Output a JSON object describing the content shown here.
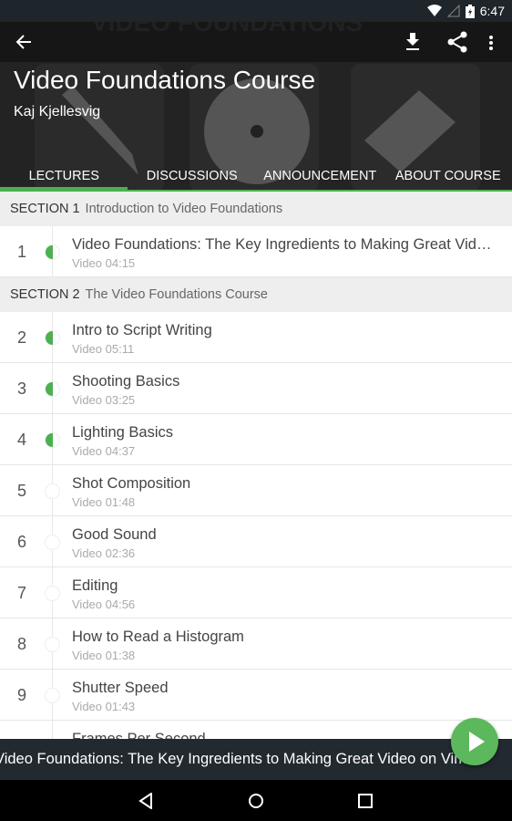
{
  "status_bar": {
    "time": "6:47",
    "icons": [
      "wifi-icon",
      "signal-icon",
      "battery-charging-icon"
    ]
  },
  "header": {
    "title": "Video Foundations Course",
    "author": "Kaj Kjellesvig",
    "actions": [
      "back-icon",
      "download-icon",
      "share-icon",
      "more-vert-icon"
    ]
  },
  "tabs": [
    {
      "label": "LECTURES",
      "active": true
    },
    {
      "label": "DISCUSSIONS"
    },
    {
      "label": "ANNOUNCEMENT"
    },
    {
      "label": "ABOUT COURSE"
    }
  ],
  "sections": [
    {
      "number": "SECTION 1",
      "title": "Introduction to Video Foundations",
      "lectures": [
        {
          "num": "1",
          "title": "Video Foundations: The Key Ingredients to Making Great Video on Vimeo",
          "sub": "Video 04:15",
          "progress": "half"
        }
      ]
    },
    {
      "number": "SECTION 2",
      "title": "The Video Foundations Course",
      "lectures": [
        {
          "num": "2",
          "title": "Intro to Script Writing",
          "sub": "Video 05:11",
          "progress": "half"
        },
        {
          "num": "3",
          "title": "Shooting Basics",
          "sub": "Video 03:25",
          "progress": "half"
        },
        {
          "num": "4",
          "title": "Lighting Basics",
          "sub": "Video 04:37",
          "progress": "half"
        },
        {
          "num": "5",
          "title": "Shot Composition",
          "sub": "Video 01:48",
          "progress": "none"
        },
        {
          "num": "6",
          "title": "Good Sound",
          "sub": "Video 02:36",
          "progress": "none"
        },
        {
          "num": "7",
          "title": "Editing",
          "sub": "Video 04:56",
          "progress": "none"
        },
        {
          "num": "8",
          "title": "How to Read a Histogram",
          "sub": "Video 01:38",
          "progress": "none"
        },
        {
          "num": "9",
          "title": "Shutter Speed",
          "sub": "Video 01:43",
          "progress": "none"
        },
        {
          "num": "10",
          "title": "Frames Per Second",
          "sub": "",
          "progress": "none"
        }
      ]
    }
  ],
  "now_playing": "Video Foundations: The Key Ingredients to Making Great Video on Vimeo",
  "colors": {
    "accent": "#4caf50",
    "fab": "#5cb85c"
  },
  "nav_bar": [
    "back-nav-icon",
    "home-nav-icon",
    "recents-nav-icon"
  ]
}
